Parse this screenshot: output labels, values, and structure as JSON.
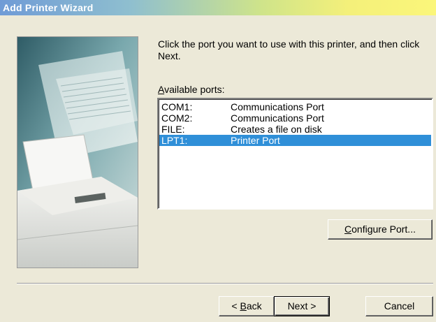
{
  "window": {
    "title": "Add Printer Wizard"
  },
  "main": {
    "instructions": "Click the port you want to use with this printer, and then click Next.",
    "ports_label_accel": "A",
    "ports_label_rest": "vailable ports:",
    "ports": [
      {
        "name": "COM1:",
        "description": "Communications Port",
        "selected": false
      },
      {
        "name": "COM2:",
        "description": "Communications Port",
        "selected": false
      },
      {
        "name": "FILE:",
        "description": "Creates a file on disk",
        "selected": false
      },
      {
        "name": "LPT1:",
        "description": "Printer Port",
        "selected": true
      }
    ],
    "configure_accel": "C",
    "configure_rest": "onfigure Port..."
  },
  "footer": {
    "back_prefix": "< ",
    "back_accel": "B",
    "back_rest": "ack",
    "next_label": "Next >",
    "cancel_label": "Cancel"
  },
  "colors": {
    "selection": "#2f8fd8",
    "dialog_bg": "#ece9d8"
  }
}
